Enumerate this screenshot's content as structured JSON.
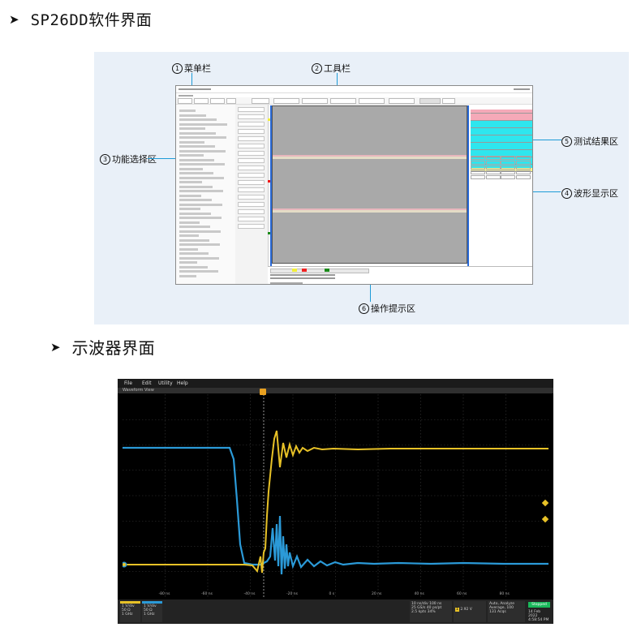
{
  "sections": {
    "software_heading": "SP26DD软件界面",
    "scope_heading": "示波器界面"
  },
  "figure1": {
    "annotations": {
      "menu_bar": {
        "num": "1",
        "label": "菜单栏"
      },
      "toolbar": {
        "num": "2",
        "label": "工具栏"
      },
      "function_select": {
        "num": "3",
        "label": "功能选择区"
      },
      "waveform": {
        "num": "4",
        "label": "波形显示区"
      },
      "results": {
        "num": "5",
        "label": "测试结果区"
      },
      "hint": {
        "num": "6",
        "label": "操作提示区"
      }
    },
    "results_colors": [
      "#f5a9b8",
      "#f5a9b8",
      "#f5a9b8",
      "#2ee6ee",
      "#2ee6ee",
      "#2ee6ee",
      "#2ee6ee",
      "#2ee6ee",
      "#2ee6ee",
      "#2ee6ee",
      "#2ee6ee",
      "#2ee6ee",
      "#2ee6ee",
      "#2ee6ee",
      "#2ee6ee",
      "#2ee6ee",
      "#f7f08a"
    ]
  },
  "figure2": {
    "menu": [
      "File",
      "Edit",
      "Utility",
      "Help"
    ],
    "view_label": "Waveform View",
    "x_ticks": [
      "-80 ns",
      "-60 ns",
      "-40 ns",
      "-20 ns",
      "0 s",
      "20 ns",
      "40 ns",
      "60 ns",
      "80 ns"
    ],
    "ch1": {
      "scale": "1 V/div",
      "impedance": "50 Ω",
      "bandwidth": "1 GHz"
    },
    "ch2": {
      "scale": "1 V/div",
      "impedance": "50 Ω",
      "bandwidth": "1 GHz"
    },
    "horizontal": {
      "scale": "10 ns/div",
      "sample_rate": "25 GS/s",
      "record": "2.5 kpts",
      "extra": [
        "100 ns",
        "40 ps/pt",
        "34%"
      ]
    },
    "trigger_level": "2.92 V",
    "acquisition": {
      "mode": "Auto,",
      "analyze": "Analyze",
      "average": "Average, 100",
      "acqs": "131 Acqs"
    },
    "stopped": "Stopped",
    "date": "14 Feb 2022",
    "time": "4:58:54 PM",
    "colors": {
      "ch1": "#e8c227",
      "ch2": "#2b9ad8",
      "stopped": "#19b85a"
    }
  }
}
